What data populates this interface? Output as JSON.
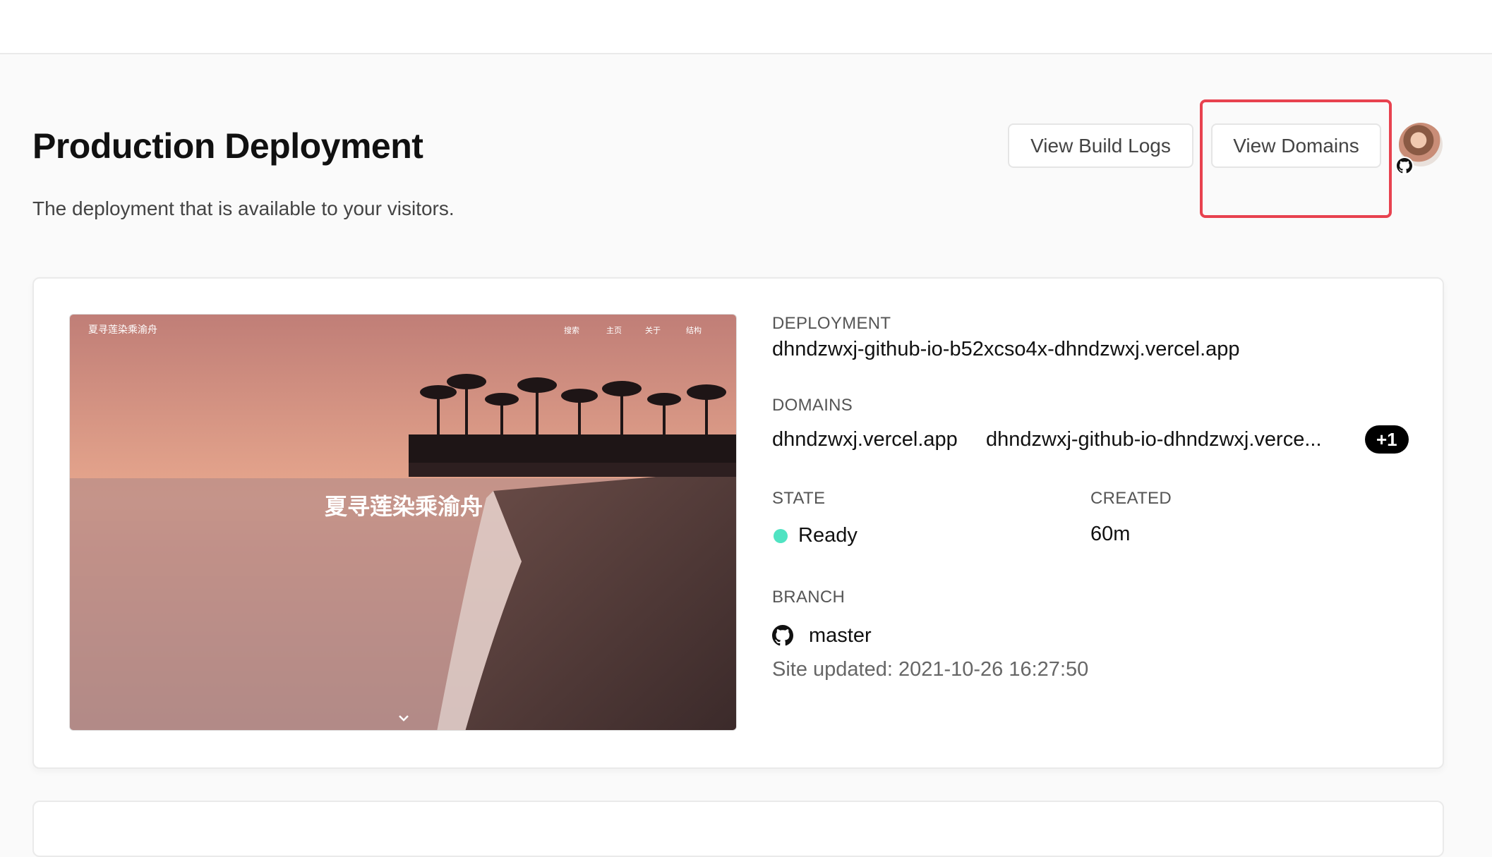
{
  "header": {
    "title": "Production Deployment",
    "subtitle": "The deployment that is available to your visitors."
  },
  "actions": {
    "build_logs_label": "View Build Logs",
    "domains_label": "View Domains"
  },
  "preview": {
    "site_title": "夏寻莲染乘渝舟",
    "hero_title": "夏寻莲染乘渝舟",
    "nav": [
      "搜索",
      "主页",
      "关于",
      "结构"
    ]
  },
  "deployment": {
    "label": "DEPLOYMENT",
    "url": "dhndzwxj-github-io-b52xcso4x-dhndzwxj.vercel.app"
  },
  "domains": {
    "label": "DOMAINS",
    "items": [
      "dhndzwxj.vercel.app",
      "dhndzwxj-github-io-dhndzwxj.verce..."
    ],
    "more": "+1"
  },
  "state": {
    "label": "STATE",
    "value": "Ready",
    "color": "#50e3c2"
  },
  "created": {
    "label": "CREATED",
    "value": "60m"
  },
  "branch": {
    "label": "BRANCH",
    "name": "master",
    "commit_message": "Site updated: 2021-10-26 16:27:50"
  },
  "colors": {
    "highlight": "#e8424f",
    "ready": "#50e3c2"
  }
}
